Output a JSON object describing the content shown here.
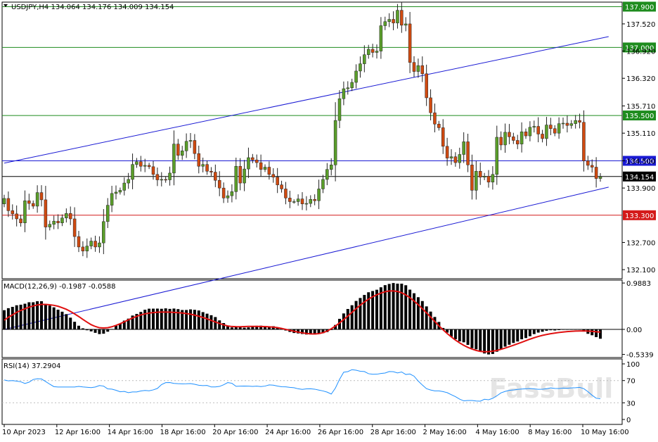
{
  "header": {
    "symbol_line": "USDJPY,H4  134.064 134.176 134.009 134.154",
    "macd_label": "MACD(12,26,9) -0.1987 -0.0588",
    "rsi_label": "RSI(14) 37.2904"
  },
  "watermark": "FassBull",
  "colors": {
    "bull": "#5a9e2a",
    "bear": "#d04a10",
    "green_line": "#1e8c1e",
    "blue_line": "#1a1ad4",
    "red_line": "#d41a1a",
    "current_line": "#000000",
    "macd_hist": "#000000",
    "macd_signal": "#e01010",
    "rsi_line": "#1e90ff"
  },
  "chart_data": [
    {
      "type": "candlestick",
      "symbol": "USDJPY",
      "timeframe": "H4",
      "ylim": [
        131.9,
        138.0
      ],
      "yticks": [
        "137.520",
        "136.920",
        "136.320",
        "135.710",
        "135.110",
        "134.500",
        "133.900",
        "132.700",
        "132.100"
      ],
      "yticks_values": [
        137.52,
        136.92,
        136.32,
        135.71,
        135.11,
        134.5,
        133.9,
        132.7,
        132.1
      ],
      "xticks": [
        "10 Apr 2023",
        "12 Apr 16:00",
        "14 Apr 16:00",
        "18 Apr 16:00",
        "20 Apr 16:00",
        "24 Apr 16:00",
        "26 Apr 16:00",
        "28 Apr 16:00",
        "2 May 16:00",
        "4 May 16:00",
        "8 May 16:00",
        "10 May 16:00"
      ],
      "horizontal_levels": [
        {
          "value": 137.9,
          "label": "137.900",
          "color": "#1e8c1e"
        },
        {
          "value": 137.0,
          "label": "137.000",
          "color": "#1e8c1e"
        },
        {
          "value": 135.5,
          "label": "135.500",
          "color": "#1e8c1e"
        },
        {
          "value": 134.5,
          "label": "134.500",
          "color": "#1a1ad4"
        },
        {
          "value": 134.154,
          "label": "134.154",
          "color": "#000000"
        },
        {
          "value": 133.3,
          "label": "133.300",
          "color": "#d41a1a"
        }
      ],
      "trend_channel": [
        {
          "from_bar": 0,
          "from_value": 134.45,
          "to_bar": 146,
          "to_value": 137.24
        },
        {
          "from_bar": 0,
          "from_value": 130.78,
          "to_bar": 146,
          "to_value": 133.92
        }
      ],
      "closes": [
        133.67,
        133.4,
        133.33,
        133.22,
        133.13,
        133.62,
        133.56,
        133.5,
        133.8,
        133.64,
        133.04,
        133.1,
        133.17,
        133.13,
        133.24,
        133.34,
        133.22,
        132.83,
        132.6,
        132.51,
        132.62,
        132.73,
        132.6,
        132.69,
        133.16,
        133.52,
        133.78,
        133.81,
        133.85,
        134.01,
        134.09,
        134.42,
        134.48,
        134.38,
        134.4,
        134.37,
        134.2,
        134.08,
        134.09,
        134.08,
        134.23,
        134.87,
        134.62,
        134.72,
        134.93,
        134.95,
        134.66,
        134.38,
        134.42,
        134.27,
        134.25,
        134.07,
        133.9,
        133.68,
        133.73,
        133.82,
        134.38,
        134.01,
        134.32,
        134.57,
        134.52,
        134.46,
        134.31,
        134.36,
        134.2,
        134.14,
        133.97,
        133.88,
        133.68,
        133.6,
        133.6,
        133.66,
        133.55,
        133.56,
        133.65,
        133.62,
        133.88,
        134.09,
        134.31,
        134.41,
        135.39,
        135.87,
        136.09,
        136.11,
        136.23,
        136.48,
        136.64,
        136.84,
        136.96,
        136.89,
        136.92,
        137.48,
        137.57,
        137.62,
        137.54,
        137.82,
        137.49,
        137.52,
        136.67,
        136.47,
        136.6,
        136.42,
        135.89,
        135.56,
        135.31,
        135.23,
        134.82,
        134.56,
        134.59,
        134.46,
        134.64,
        134.92,
        134.41,
        133.85,
        134.27,
        134.14,
        134.16,
        134.03,
        134.2,
        135.02,
        134.85,
        135.13,
        135.03,
        134.95,
        134.87,
        135.14,
        135.05,
        135.24,
        135.26,
        135.09,
        134.99,
        135.29,
        135.21,
        135.11,
        135.32,
        135.33,
        135.28,
        135.32,
        135.39,
        135.35,
        134.5,
        134.4,
        134.36,
        134.11,
        134.15
      ],
      "series": [
        {
          "name": "Close",
          "values": "see closes"
        }
      ]
    },
    {
      "type": "bar",
      "name": "MACD(12,26,9)",
      "ylim": [
        -0.6,
        1.05
      ],
      "yticks": [
        "0.9883",
        "0.00",
        "-0.5339"
      ],
      "yticks_values": [
        0.9883,
        0.0,
        -0.5339
      ],
      "main": -0.1987,
      "signal": -0.0588,
      "histogram": [
        0.409,
        0.452,
        0.48,
        0.514,
        0.526,
        0.547,
        0.578,
        0.578,
        0.6,
        0.6,
        0.541,
        0.508,
        0.47,
        0.42,
        0.377,
        0.325,
        0.25,
        0.162,
        0.078,
        0.023,
        -0.018,
        -0.042,
        -0.073,
        -0.1,
        -0.092,
        -0.049,
        0.009,
        0.077,
        0.126,
        0.187,
        0.229,
        0.295,
        0.33,
        0.372,
        0.419,
        0.441,
        0.442,
        0.443,
        0.439,
        0.448,
        0.437,
        0.444,
        0.432,
        0.413,
        0.414,
        0.426,
        0.417,
        0.403,
        0.368,
        0.335,
        0.302,
        0.263,
        0.192,
        0.135,
        0.08,
        0.042,
        0.055,
        0.048,
        0.037,
        0.043,
        0.068,
        0.077,
        0.079,
        0.07,
        0.064,
        0.068,
        0.043,
        0.012,
        -0.024,
        -0.054,
        -0.077,
        -0.086,
        -0.098,
        -0.109,
        -0.107,
        -0.109,
        -0.095,
        -0.081,
        -0.057,
        -0.014,
        0.095,
        0.225,
        0.34,
        0.435,
        0.515,
        0.606,
        0.669,
        0.734,
        0.791,
        0.818,
        0.845,
        0.897,
        0.943,
        0.969,
        0.988,
        0.975,
        0.974,
        0.941,
        0.847,
        0.77,
        0.686,
        0.604,
        0.49,
        0.379,
        0.265,
        0.159,
        0.031,
        -0.069,
        -0.156,
        -0.209,
        -0.256,
        -0.275,
        -0.33,
        -0.401,
        -0.424,
        -0.474,
        -0.513,
        -0.534,
        -0.524,
        -0.476,
        -0.427,
        -0.368,
        -0.327,
        -0.289,
        -0.258,
        -0.211,
        -0.184,
        -0.146,
        -0.1,
        -0.068,
        -0.05,
        -0.029,
        -0.018,
        -0.022,
        -0.015,
        -0.005,
        -0.002,
        -0.003,
        -0.001,
        0.0,
        -0.047,
        -0.094,
        -0.125,
        -0.164,
        -0.199
      ],
      "signal_line": [
        0.195,
        0.259,
        0.31,
        0.364,
        0.403,
        0.439,
        0.474,
        0.5,
        0.521,
        0.533,
        0.532,
        0.525,
        0.513,
        0.493,
        0.463,
        0.428,
        0.383,
        0.33,
        0.274,
        0.213,
        0.155,
        0.1,
        0.062,
        0.035,
        0.03,
        0.036,
        0.056,
        0.085,
        0.121,
        0.161,
        0.204,
        0.243,
        0.278,
        0.308,
        0.331,
        0.347,
        0.359,
        0.366,
        0.37,
        0.37,
        0.367,
        0.362,
        0.357,
        0.348,
        0.338,
        0.324,
        0.304,
        0.281,
        0.254,
        0.225,
        0.191,
        0.159,
        0.127,
        0.097,
        0.073,
        0.061,
        0.058,
        0.057,
        0.06,
        0.063,
        0.064,
        0.063,
        0.062,
        0.06,
        0.055,
        0.048,
        0.037,
        0.02,
        0.001,
        -0.02,
        -0.039,
        -0.058,
        -0.074,
        -0.087,
        -0.096,
        -0.098,
        -0.091,
        -0.07,
        -0.036,
        0.013,
        0.072,
        0.138,
        0.209,
        0.284,
        0.363,
        0.441,
        0.517,
        0.584,
        0.644,
        0.696,
        0.738,
        0.774,
        0.803,
        0.82,
        0.82,
        0.808,
        0.781,
        0.735,
        0.676,
        0.605,
        0.527,
        0.442,
        0.353,
        0.263,
        0.17,
        0.077,
        -0.008,
        -0.088,
        -0.161,
        -0.228,
        -0.287,
        -0.339,
        -0.383,
        -0.419,
        -0.448,
        -0.469,
        -0.476,
        -0.474,
        -0.464,
        -0.448,
        -0.425,
        -0.398,
        -0.369,
        -0.338,
        -0.306,
        -0.274,
        -0.241,
        -0.208,
        -0.178,
        -0.151,
        -0.128,
        -0.109,
        -0.092,
        -0.078,
        -0.066,
        -0.056,
        -0.047,
        -0.041,
        -0.036,
        -0.033,
        -0.032,
        -0.035,
        -0.042,
        -0.051,
        -0.059
      ]
    },
    {
      "type": "line",
      "name": "RSI(14)",
      "ylim": [
        0,
        100
      ],
      "yticks": [
        "100",
        "70",
        "30",
        "0"
      ],
      "yticks_values": [
        100,
        70,
        30,
        0
      ],
      "levels": [
        70,
        30
      ],
      "value": 37.2904,
      "values": [
        71.09,
        69.41,
        70.01,
        69.02,
        67.81,
        64.82,
        67.09,
        71.94,
        73.29,
        72.89,
        68.28,
        63.47,
        59.08,
        58.41,
        58.41,
        58.41,
        58.41,
        58.41,
        59.52,
        58.56,
        57.92,
        57.25,
        58.44,
        61.09,
        60.06,
        55.03,
        54.53,
        52.55,
        49.88,
        50.43,
        48.33,
        49.5,
        49.52,
        51.22,
        52.17,
        51.55,
        53.23,
        55.84,
        62.78,
        66.23,
        66.48,
        64.93,
        64.37,
        64.16,
        64.23,
        64.6,
        63.35,
        61.58,
        60.87,
        61.27,
        58.5,
        58.58,
        59.45,
        62.45,
        66.36,
        65.13,
        59.67,
        59.91,
        60.14,
        60.04,
        59.57,
        59.93,
        59.17,
        60.04,
        62.16,
        61.73,
        60.12,
        58.89,
        58.71,
        57.78,
        57.15,
        55.16,
        54.09,
        55.08,
        55.23,
        54.5,
        52.88,
        51.35,
        49.21,
        45.72,
        56.49,
        72.22,
        85.0,
        86.09,
        89.6,
        88.56,
        86.74,
        86.24,
        82.36,
        81.3,
        81.41,
        82.73,
        83.57,
        86.21,
        85.87,
        83.74,
        85.46,
        80.95,
        81.78,
        77.88,
        69.11,
        61.95,
        55.45,
        52.98,
        51.49,
        51.43,
        50.1,
        48.25,
        44.53,
        41.0,
        36.57,
        33.5,
        34.1,
        34.14,
        33.28,
        32.98,
        36.36,
        35.46,
        38.12,
        42.55,
        47.84,
        50.48,
        52.39,
        53.09,
        54.04,
        54.73,
        55.16,
        55.62,
        55.06,
        54.22,
        54.42,
        55.26,
        56.72,
        55.9,
        55.66,
        56.44,
        56.21,
        56.88,
        57.12,
        57.72,
        55.44,
        50.02,
        43.61,
        38.19,
        37.29
      ]
    }
  ]
}
